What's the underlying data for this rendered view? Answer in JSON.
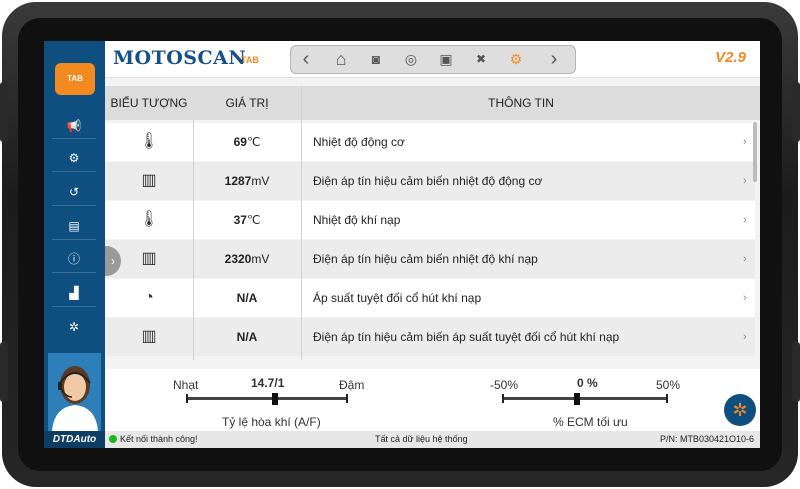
{
  "app": {
    "title": "MOTOSCAN",
    "title_sub": "TAB",
    "version": "V2.9",
    "brand": "DTDAuto",
    "logo_text": "TAB"
  },
  "toolbar": {
    "buttons": [
      {
        "icon": "back-icon",
        "glyph": "‹"
      },
      {
        "icon": "home-icon",
        "glyph": "⌂"
      },
      {
        "icon": "camera-icon",
        "glyph": "◙"
      },
      {
        "icon": "record-icon",
        "glyph": "◎"
      },
      {
        "icon": "folder-icon",
        "glyph": "▣"
      },
      {
        "icon": "delete-icon",
        "glyph": "✖"
      },
      {
        "icon": "ai-icon",
        "glyph": "⚙"
      },
      {
        "icon": "forward-icon",
        "glyph": "›"
      }
    ]
  },
  "sidebar": {
    "items": [
      {
        "icon": "megaphone-icon",
        "glyph": "📢"
      },
      {
        "icon": "engine-icon",
        "glyph": "⚙"
      },
      {
        "icon": "history-icon",
        "glyph": "↺"
      },
      {
        "icon": "clipboard-icon",
        "glyph": "▤"
      },
      {
        "icon": "info-icon",
        "glyph": "ⓘ"
      },
      {
        "icon": "factory-icon",
        "glyph": "▟"
      },
      {
        "icon": "settings-icon",
        "glyph": "✲"
      }
    ]
  },
  "table": {
    "headers": {
      "icon": "BIỂU TƯỢNG",
      "value": "GIÁ TRỊ",
      "info": "THÔNG TIN"
    },
    "rows": [
      {
        "icon": "engine-temperature-icon",
        "glyph": "🌡",
        "value": "69",
        "unit": "℃",
        "info": "Nhiệt độ động cơ"
      },
      {
        "icon": "ect-sensor-icon",
        "glyph": "▥",
        "value": "1287",
        "unit": "mV",
        "info": "Điện áp tín hiệu cảm biến nhiệt độ động cơ"
      },
      {
        "icon": "intake-temperature-icon",
        "glyph": "🌡",
        "value": "37",
        "unit": "℃",
        "info": "Nhiệt độ khí nạp"
      },
      {
        "icon": "iat-sensor-icon",
        "glyph": "▥",
        "value": "2320",
        "unit": "mV",
        "info": "Điện áp tín hiệu cảm biến nhiệt độ khí nạp"
      },
      {
        "icon": "gauge-icon",
        "glyph": "◔",
        "value": "N/A",
        "unit": "",
        "info": "Áp suất tuyệt đối cổ hút khí nạp"
      },
      {
        "icon": "map-sensor-icon",
        "glyph": "▥",
        "value": "N/A",
        "unit": "",
        "info": "Điện áp tín hiệu cảm biến áp suất tuyệt đối cổ hút khí nạp"
      }
    ]
  },
  "afr_gauge": {
    "left_label": "Nhạt",
    "right_label": "Đậm",
    "value": "14.7/1",
    "caption": "Tỷ lệ hòa khí (A/F)",
    "position": 0.55
  },
  "ecm_gauge": {
    "left_label": "-50%",
    "right_label": "50%",
    "value": "0 %",
    "caption": "% ECM tối ưu",
    "position": 0.45
  },
  "status": {
    "connection": "Kết nối thành công!",
    "center": "Tất cả dữ liệu hệ thống",
    "part_number": "P/N: MTB030421O10-6"
  },
  "colors": {
    "sidebar": "#0f4f7f",
    "accent": "#f28a1f",
    "ok": "#1fb81f"
  }
}
